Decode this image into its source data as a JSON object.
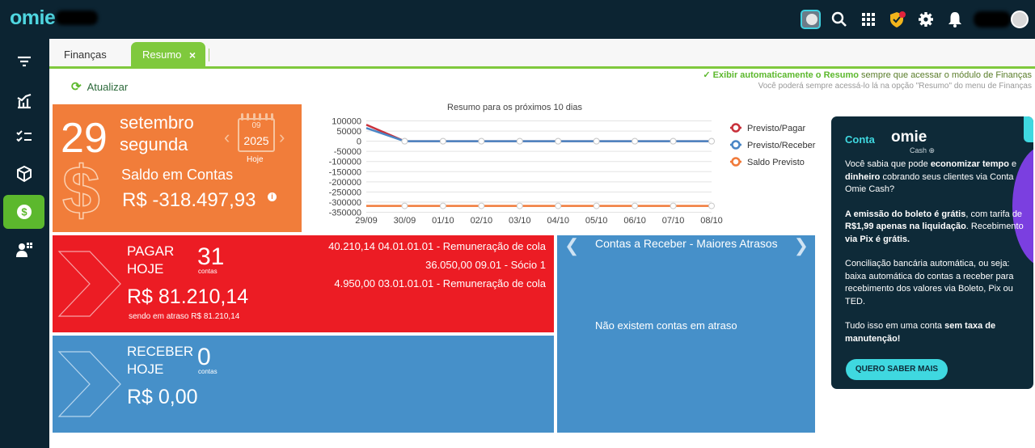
{
  "topbar": {
    "logo": "omie",
    "icons": [
      "toggle-icon",
      "search-icon",
      "apps-grid-icon",
      "shield-badge-icon",
      "gear-icon",
      "bell-icon"
    ]
  },
  "sidebar": {
    "items": [
      "filter-icon",
      "chart-arrow-icon",
      "checklist-icon",
      "cube-icon",
      "dollar-icon",
      "people-add-icon"
    ],
    "active": "dollar-icon"
  },
  "tabs": {
    "financas": "Finanças",
    "resumo": "Resumo",
    "close": "×"
  },
  "toolbar": {
    "refresh_label": "Atualizar",
    "auto_bold": "Exibir automaticamente o Resumo",
    "auto_rest": "sempre que acessar o módulo de Finanças",
    "auto_sub": "Você poderá sempre acessá-lo lá na opção \"Resumo\" do menu de Finanças"
  },
  "date_tile": {
    "day": "29",
    "month": "setembro",
    "weekday": "segunda",
    "cal_month": "09",
    "cal_year": "2025",
    "cal_today": "Hoje",
    "saldo_label": "Saldo em Contas",
    "saldo_value": "R$ -318.497,93",
    "color": "#f17d3a"
  },
  "chart_data": {
    "type": "line",
    "title": "Resumo para os próximos 10 dias",
    "categories": [
      "29/09",
      "30/09",
      "01/10",
      "02/10",
      "03/10",
      "04/10",
      "05/10",
      "06/10",
      "07/10",
      "08/10"
    ],
    "yticks": [
      100000,
      50000,
      0,
      -50000,
      -100000,
      -150000,
      -200000,
      -250000,
      -300000,
      -350000
    ],
    "ytick_labels": [
      "100000",
      "50000",
      "0",
      "-50000",
      "-100000",
      "-150000",
      "-200000",
      "-250000",
      "-300000",
      "-350000"
    ],
    "ylim": [
      -360000,
      110000
    ],
    "series": [
      {
        "name": "Previsto/Pagar",
        "color": "#c8303a",
        "values": [
          81210,
          0,
          0,
          0,
          0,
          0,
          0,
          0,
          0,
          0
        ]
      },
      {
        "name": "Previsto/Receber",
        "color": "#4a86c5",
        "values": [
          65000,
          0,
          0,
          0,
          0,
          0,
          0,
          0,
          0,
          0
        ]
      },
      {
        "name": "Saldo Previsto",
        "color": "#f07a3a",
        "values": [
          -318498,
          -318498,
          -318498,
          -318498,
          -318498,
          -318498,
          -318498,
          -318498,
          -318498,
          -318498
        ]
      }
    ],
    "legend": "right",
    "grid": true
  },
  "pagar": {
    "label_line1": "PAGAR",
    "label_line2": "HOJE",
    "count": "31",
    "count_sub": "contas",
    "value": "R$ 81.210,14",
    "late": "sendo em atraso R$ 81.210,14",
    "items": [
      "40.210,14 04.01.01.01 - Remuneração de cola",
      "36.050,00 09.01 - Sócio 1",
      "4.950,00 03.01.01.01 - Remuneração de cola"
    ],
    "color": "#ec1c24"
  },
  "receber": {
    "label_line1": "RECEBER",
    "label_line2": "HOJE",
    "count": "0",
    "count_sub": "contas",
    "value": "R$ 0,00",
    "color": "#4690c9"
  },
  "atrasos": {
    "title": "Contas a Receber - Maiores Atrasos",
    "empty": "Não existem contas em atraso",
    "prev": "❮",
    "next": "❯"
  },
  "ad": {
    "conta": "Conta",
    "logo": "omie",
    "cash": "Cash",
    "cta": "QUERO SABER MAIS"
  }
}
